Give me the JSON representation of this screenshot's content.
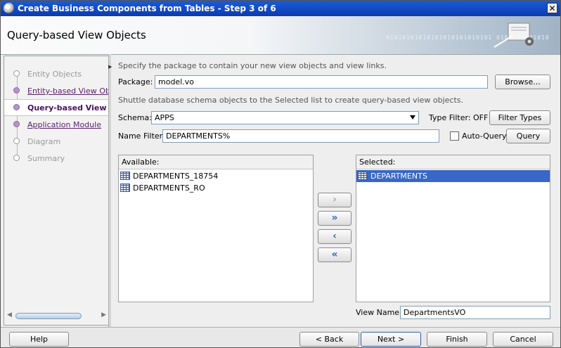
{
  "window": {
    "title": "Create Business Components from Tables - Step 3 of 6"
  },
  "header": {
    "title": "Query-based View Objects",
    "binary_text": "01010101010101010101010101 0101010101010"
  },
  "nav": {
    "items": [
      {
        "label": "Entity Objects",
        "state": "disabled"
      },
      {
        "label": "Entity-based View Obje",
        "state": "visited"
      },
      {
        "label": "Query-based View O",
        "state": "active"
      },
      {
        "label": "Application Module",
        "state": "visited"
      },
      {
        "label": "Diagram",
        "state": "disabled"
      },
      {
        "label": "Summary",
        "state": "disabled"
      }
    ]
  },
  "main": {
    "package_instruction": "Specify the package to contain your new view objects and view links.",
    "package_label": "Package:",
    "package_value": "model.vo",
    "browse_label": "Browse...",
    "shuttle_instruction": "Shuttle database schema objects to the Selected list to create query-based view objects.",
    "schema_label": "Schema:",
    "schema_value": "APPS",
    "type_filter_label": "Type Filter: OFF",
    "filter_types_label": "Filter Types",
    "name_filter_label": "Name Filter:",
    "name_filter_value": "DEPARTMENTS%",
    "auto_query_label": "Auto-Query",
    "query_label": "Query",
    "available": {
      "header": "Available:",
      "items": [
        "DEPARTMENTS_18754",
        "DEPARTMENTS_RO"
      ]
    },
    "selected": {
      "header": "Selected:",
      "items": [
        "DEPARTMENTS"
      ]
    },
    "view_name_label": "View Name:",
    "view_name_value": "DepartmentsVO"
  },
  "shuttle": {
    "move_right": "›",
    "move_all_right": "»",
    "move_left": "‹",
    "move_all_left": "«"
  },
  "footer": {
    "help": "Help",
    "back": "< Back",
    "next": "Next >",
    "finish": "Finish",
    "cancel": "Cancel"
  },
  "colors": {
    "selection": "#3867c7",
    "link": "#5a1e6f",
    "title_bar": "#0a3bb3"
  }
}
